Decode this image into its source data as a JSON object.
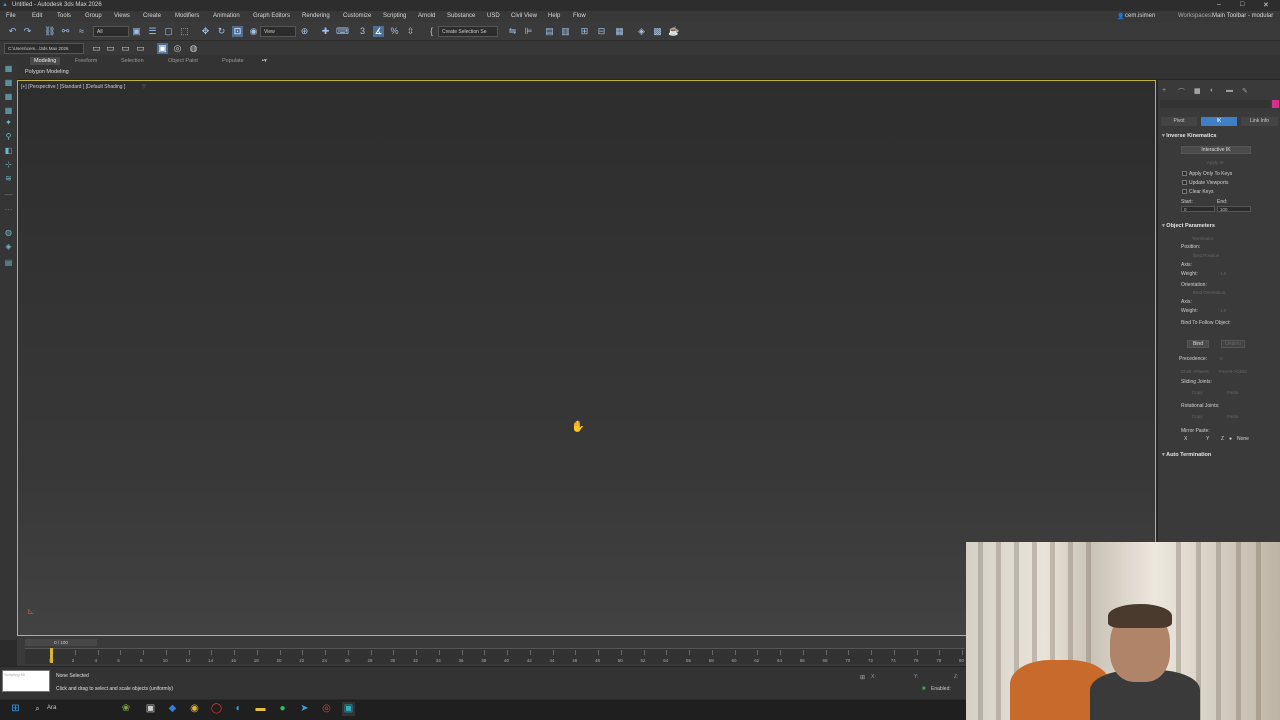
{
  "window": {
    "title": "Untitled - Autodesk 3ds Max 2026",
    "controls": [
      "–",
      "□",
      "✕"
    ]
  },
  "menu": {
    "items": [
      "File",
      "Edit",
      "Tools",
      "Group",
      "Views",
      "Create",
      "Modifiers",
      "Animation",
      "Graph Editors",
      "Rendering",
      "Customize",
      "Scripting",
      "Arnold",
      "Substance",
      "USD",
      "Civil View",
      "Help",
      "Flow"
    ],
    "user": "cem.isimen",
    "workspaces_label": "Workspaces:",
    "workspace": "Main Toolbar - modular"
  },
  "toolbar": {
    "selection_filter": "All",
    "ref_coord": "View",
    "named_selection": "Create Selection Se",
    "path": "C:\\Users\\cem...\\3ds Max 2026"
  },
  "ribbon": {
    "tabs": [
      "Modeling",
      "Freeform",
      "Selection",
      "Object Paint",
      "Populate"
    ],
    "active_tab": "Modeling",
    "sub_label": "Polygon Modeling"
  },
  "viewport": {
    "label": "[+] [Perspective ] [Standard ] [Default Shading ]",
    "filter_icon": "funnel-icon",
    "border_color": "#c6b23e"
  },
  "command_panel": {
    "tabs": [
      "Pivot",
      "IK",
      "Link Info"
    ],
    "active_tab": "IK",
    "ik_rollout": {
      "title": "Inverse Kinematics",
      "interactive_ik": "Interactive IK",
      "apply_ik": "Apply IK",
      "apply_only_keys": "Apply Only To Keys",
      "update_viewports": "Update Viewports",
      "clear_keys": "Clear Keys",
      "start_label": "Start:",
      "end_label": "End:",
      "start_value": "0",
      "end_value": "100"
    },
    "object_params": {
      "title": "Object Parameters",
      "terminator": "Terminator",
      "position": "Position:",
      "bind_position": "Bind Position",
      "axis": "Axis:",
      "weight": "Weight:",
      "weight_value": "1.0",
      "orientation": "Orientation:",
      "bind_orientation": "Bind Orientation",
      "bind_follow": "Bind To Follow Object:",
      "bind_btn": "Bind",
      "unbind_btn": "Unbind",
      "precedence": "Precedence:",
      "precedence_value": "0",
      "child_parent": "Child->Parent",
      "parent_child": "Parent->Child",
      "sliding_joints": "Sliding Joints:",
      "rotational_joints": "Rotational Joints:",
      "copy": "Copy",
      "paste": "Paste",
      "mirror_paste": "Mirror Paste:",
      "mirror_axes": [
        "X",
        "Y",
        "Z"
      ],
      "mirror_none": "None"
    },
    "auto_termination": "Auto Termination"
  },
  "timeline": {
    "slider": "0 / 100",
    "ticks": [
      "0",
      "2",
      "4",
      "6",
      "8",
      "10",
      "12",
      "14",
      "16",
      "18",
      "20",
      "22",
      "24",
      "26",
      "28",
      "30",
      "32",
      "34",
      "36",
      "38",
      "40",
      "42",
      "44",
      "46",
      "48",
      "50",
      "52",
      "54",
      "56",
      "58",
      "60",
      "62",
      "64",
      "66",
      "68",
      "70",
      "72",
      "74",
      "76",
      "78",
      "80"
    ],
    "current_frame": 0
  },
  "status": {
    "maxscript": "Scripting Mi",
    "selection": "None Selected",
    "prompt": "Click and drag to select and scale objects (uniformly)",
    "enabled_label": "Enabled:"
  },
  "taskbar": {
    "search": "Ara"
  }
}
